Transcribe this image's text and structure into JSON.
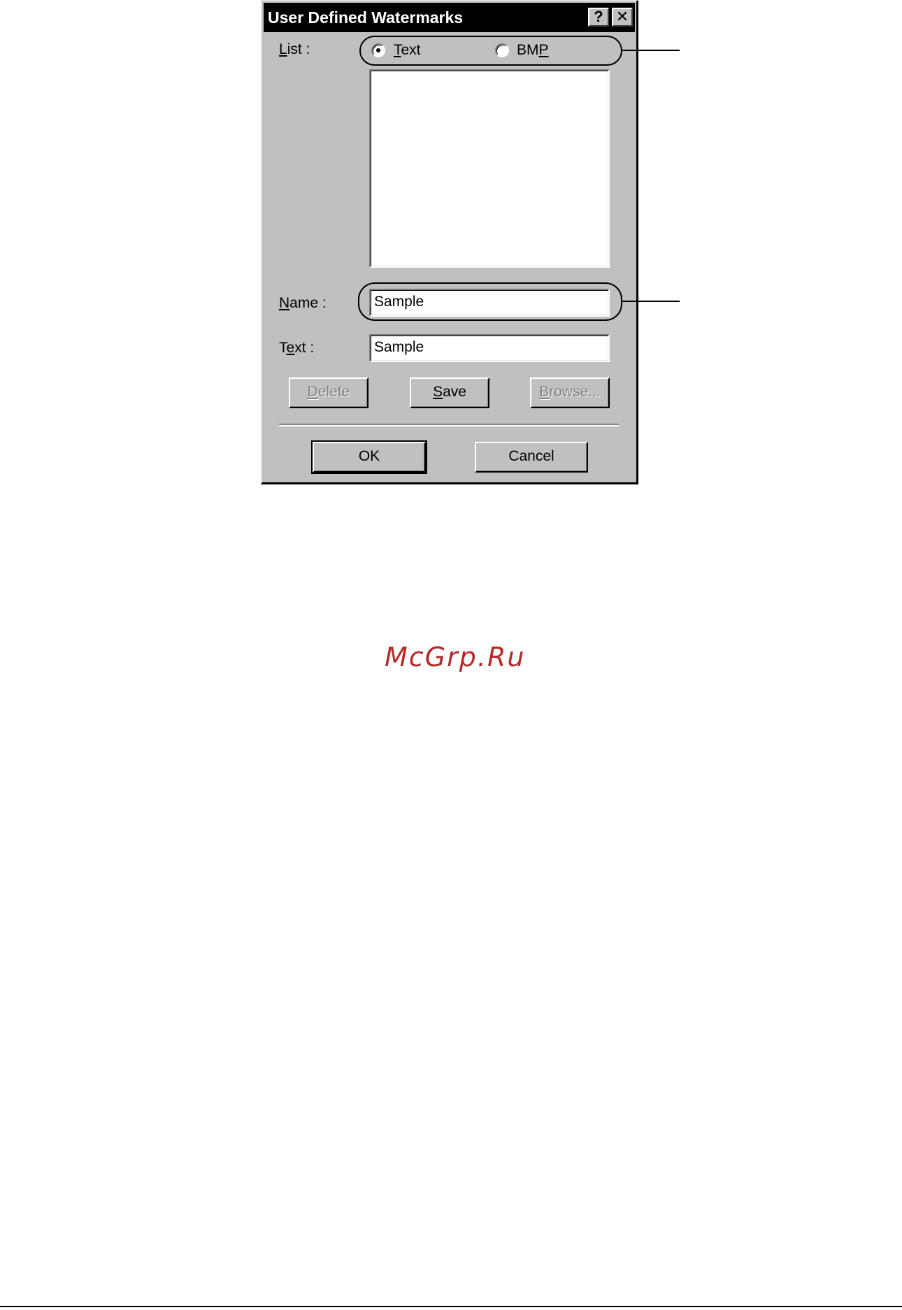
{
  "dialog": {
    "title": "User Defined Watermarks",
    "help_glyph": "?",
    "close_glyph": "✕",
    "list_label": "List :",
    "radio_text": {
      "label": "Text",
      "selected": true
    },
    "radio_bmp": {
      "label": "BMP",
      "selected": false
    },
    "name_label": "Name :",
    "name_value": "Sample",
    "text_label": "Text :",
    "text_value": "Sample",
    "buttons": {
      "delete": "Delete",
      "save": "Save",
      "browse": "Browse...",
      "ok": "OK",
      "cancel": "Cancel"
    }
  },
  "watermark": "McGrp.Ru",
  "colors": {
    "dialog_face": "#c0c0c0",
    "titlebar": "#000000",
    "watermark": "#b52b2b"
  }
}
